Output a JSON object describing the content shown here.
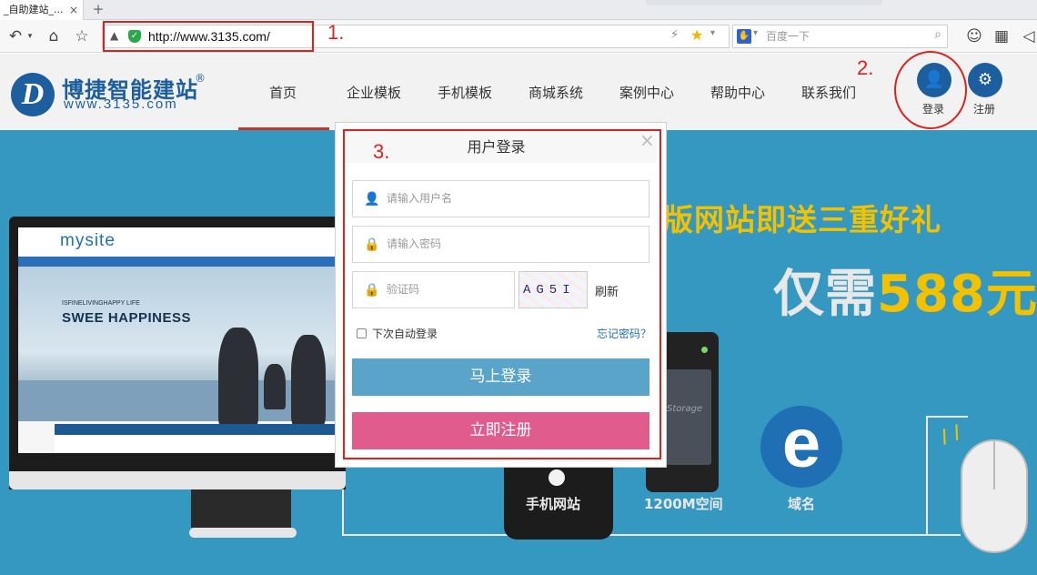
{
  "browser": {
    "tab_title": "_自助建站_...",
    "tab_close": "×",
    "new_tab": "+",
    "url": "http://www.3135.com/",
    "search_placeholder": "百度一下"
  },
  "annotations": {
    "step1": "1.",
    "step2": "2.",
    "step3": "3."
  },
  "site": {
    "logo_text": "博捷智能建站",
    "logo_reg": "®",
    "logo_url": "www.3135.com",
    "nav": [
      "首页",
      "企业模板",
      "手机模板",
      "商城系统",
      "案例中心",
      "帮助中心",
      "联系我们"
    ],
    "active_nav": "首页",
    "login_label": "登录",
    "register_label": "注册"
  },
  "banner": {
    "promo_text": "版网站即送三重好礼",
    "price_prefix": "仅需",
    "price_value": "588元",
    "devices": [
      "手机网站",
      "1200M空间",
      "域名"
    ],
    "mockup": {
      "logo": "mysite",
      "headline": "SWEE HAPPINESS",
      "tagline": "ISFINELIVINGHAPPY LIFE",
      "server_label": "Storage"
    }
  },
  "login_modal": {
    "title": "用户登录",
    "close": "×",
    "username_placeholder": "请输入用户名",
    "password_placeholder": "请输入密码",
    "captcha_placeholder": "验证码",
    "captcha_image_text": "AG5I",
    "refresh_label": "刷新",
    "remember_label": "下次自动登录",
    "remember_checked": false,
    "forgot_label": "忘记密码？",
    "login_button": "马上登录",
    "register_button": "立即注册"
  },
  "colors": {
    "annotation_red": "#e02020",
    "brand_blue": "#1d5e9e",
    "banner_blue": "#3498c0",
    "promo_yellow": "#f2c200",
    "login_button": "#5aa3c9",
    "register_button": "#e05c8d"
  }
}
